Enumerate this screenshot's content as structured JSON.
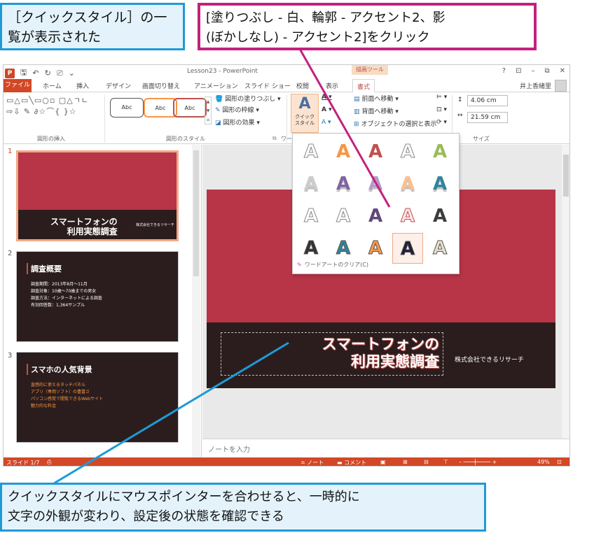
{
  "window": {
    "title": "Lesson23 - PowerPoint",
    "context_tab_group": "描画ツール",
    "controls": [
      "?",
      "⊡",
      "–",
      "⧉",
      "✕"
    ],
    "user": "井上香緒里"
  },
  "tabs": [
    "ファイル",
    "ホーム",
    "挿入",
    "デザイン",
    "画面切り替え",
    "アニメーション",
    "スライド ショー",
    "校閲",
    "表示",
    "書式"
  ],
  "ribbon": {
    "groups": {
      "insert_shapes": "図形の挿入",
      "shape_styles": "図形のスタイル",
      "wordart_styles": "ワー",
      "size": "サイズ"
    },
    "shapes_glyphs": "▭△▭╲▭○▫ ▢△ㄱㄴ⇨⇩ ✎ ∂☆⌒{ }☆",
    "style_swatch_text": [
      "Abc",
      "Abc",
      "Abc"
    ],
    "shape_fill": "図形の塗りつぶし",
    "shape_outline": "図形の枠線",
    "shape_effects": "図形の効果",
    "quick_style_top": "クイック",
    "quick_style_bottom": "スタイル",
    "bring_forward": "前面へ移動",
    "send_backward": "背面へ移動",
    "selection_pane": "オブジェクトの選択と表示",
    "height": "4.06 cm",
    "width": "21.59 cm"
  },
  "slides": [
    {
      "number": "1",
      "title_line1": "スマートフォンの",
      "title_line2": "利用実態調査",
      "subtitle": "株式会社できるリサーチ"
    },
    {
      "number": "2",
      "title": "調査概要",
      "lines": [
        "調査期間：2013年8月～11月",
        "調査対象：10歳～70歳までの男女",
        "調査方法：インターネットによる調査",
        "有効回答数：1,364サンプル"
      ]
    },
    {
      "number": "3",
      "title": "スマホの人気背景",
      "lines": [
        "直感的に使えるタッチパネル",
        "アプリ（専用ソフト）の豊富さ",
        "パソコン感覚で閲覧できるWebサイト",
        "魅力的な料金"
      ]
    }
  ],
  "main_slide": {
    "title_line1": "スマートフォンの",
    "title_line2": "利用実態調査",
    "company": "株式会社できるリサーチ"
  },
  "notes_placeholder": "ノートを入力",
  "gallery": {
    "glyph": "A",
    "colors": [
      [
        "#ffffff",
        "#f79646",
        "#c0504d",
        "#ffffff",
        "#9bbb59"
      ],
      [
        "#cccccc",
        "#8064a2",
        "#b39bc8",
        "#fac08f",
        "#31849b"
      ],
      [
        "#ffffff",
        "#ffffff",
        "#5f497a",
        "#fbe5e5",
        "#3c3c3c"
      ],
      [
        "#333333",
        "#31849b",
        "#f79646",
        "#1f1f3a",
        "#e6e0cc"
      ]
    ],
    "hovered_cell": "row4-col4",
    "clear_label": "ワードアートのクリア(C)"
  },
  "statusbar": {
    "slide_counter": "スライド 1/7",
    "notes": "ノート",
    "comments": "コメント",
    "zoom": "49%"
  },
  "callouts": {
    "top_left": "［クイックスタイル］の一覧が表示された",
    "top_right_line1": "[塗りつぶし - 白、輪郭 - アクセント2、影",
    "top_right_line2": "(ぼかしなし) - アクセント2]をクリック",
    "bottom_line1": "クイックスタイルにマウスポインターを合わせると、一時的に",
    "bottom_line2": "文字の外観が変わり、設定後の状態を確認できる"
  },
  "colors": {
    "accent_orange": "#d24726",
    "slide_red": "#b83447",
    "slide_dark": "#2b1d1d",
    "callout_blue": "#1e9ad6",
    "callout_magenta": "#c2217f"
  }
}
